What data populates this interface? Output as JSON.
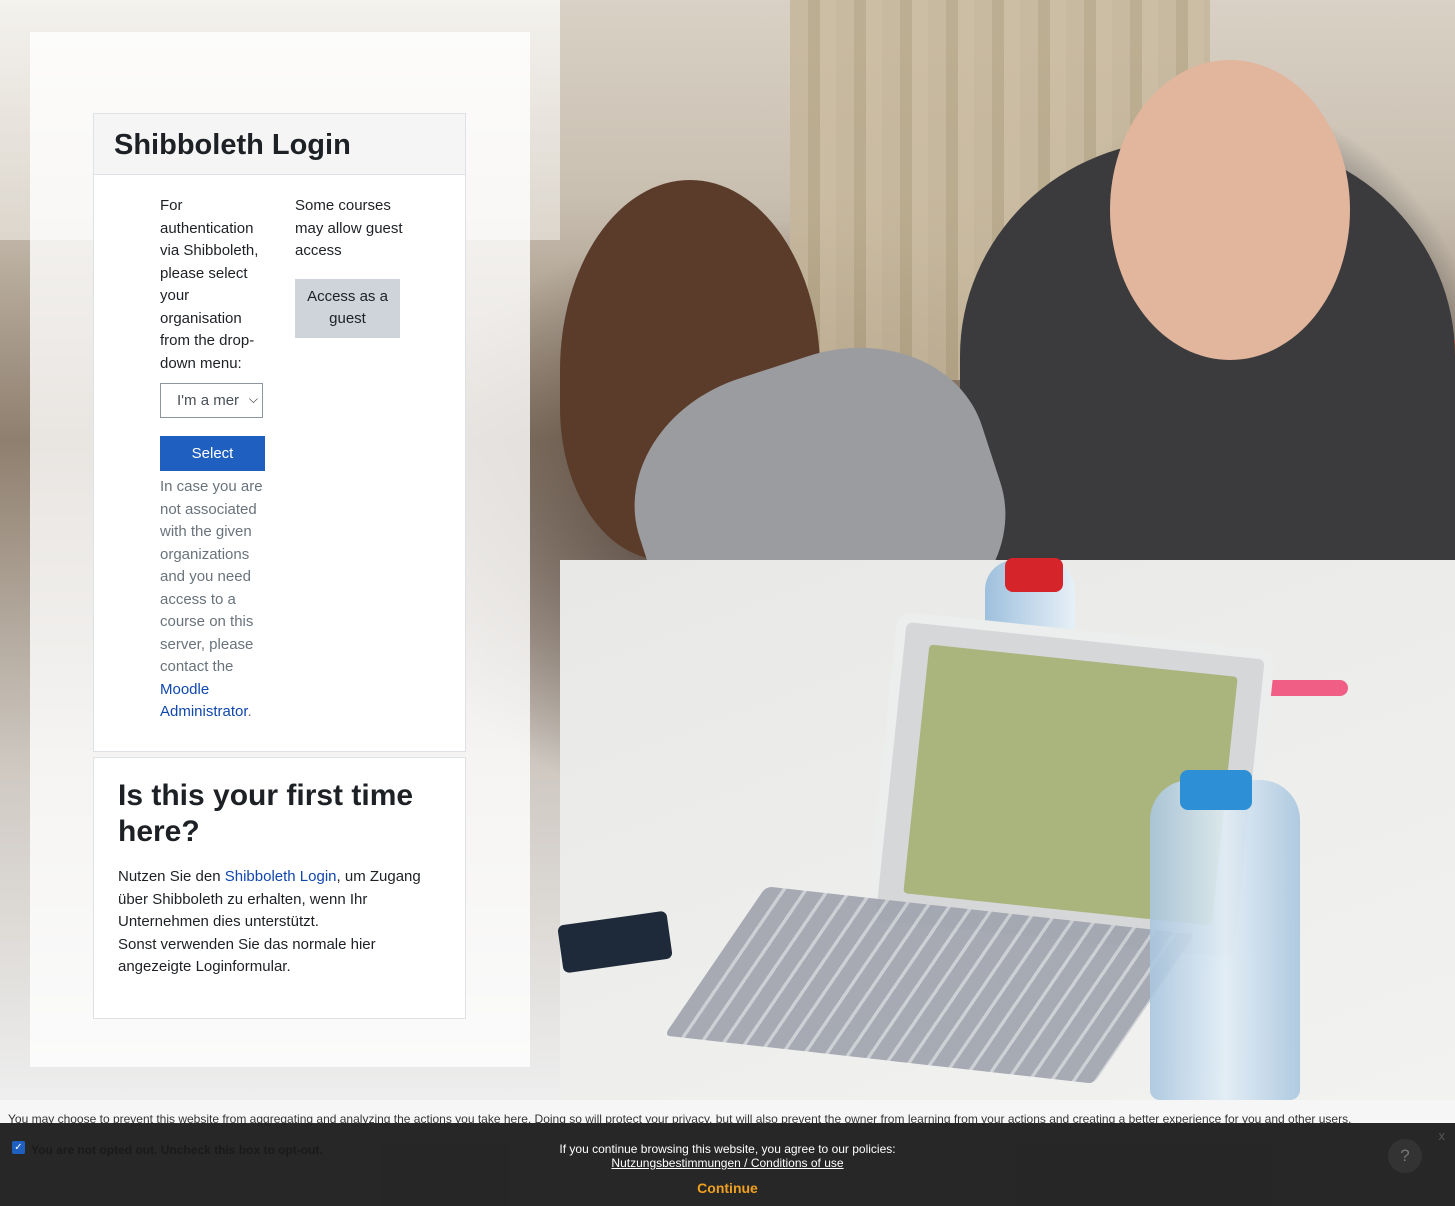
{
  "login": {
    "title": "Shibboleth Login",
    "instructions": "For authentication via Shibboleth, please select your organisation from the drop-down menu:",
    "organisation_select_value": "I'm a mer",
    "select_button": "Select",
    "help_text": "In case you are not associated with the given organizations and you need access to a course on this server, please contact the",
    "help_link": "Moodle Administrator",
    "help_suffix": ".",
    "guest_text": "Some courses may allow guest access",
    "guest_button": "Access as a guest"
  },
  "first_time": {
    "title": "Is this your first time here?",
    "body_prefix": "Nutzen Sie den ",
    "body_link": "Shibboleth Login",
    "body_suffix": ", um Zugang über Shibboleth zu erhalten, wenn Ihr Unternehmen dies unterstützt.",
    "body_line2": "Sonst verwenden Sie das normale hier angezeigte Loginformular."
  },
  "optout": {
    "text": "You may choose to prevent this website from aggregating and analyzing the actions you take here. Doing so will protect your privacy, but will also prevent the owner from learning from your actions and creating a better experience for you and other users.",
    "checkbox_label": "You are not opted out. Uncheck this box to opt-out."
  },
  "cookie_banner": {
    "message": "If you continue browsing this website, you agree to our policies:",
    "policy_link": "Nutzungsbestimmungen / Conditions of use",
    "continue": "Continue",
    "close": "x",
    "help": "?"
  },
  "colors": {
    "primary": "#1f5fbf",
    "link": "#0f47ad",
    "continue": "#f0a020"
  }
}
